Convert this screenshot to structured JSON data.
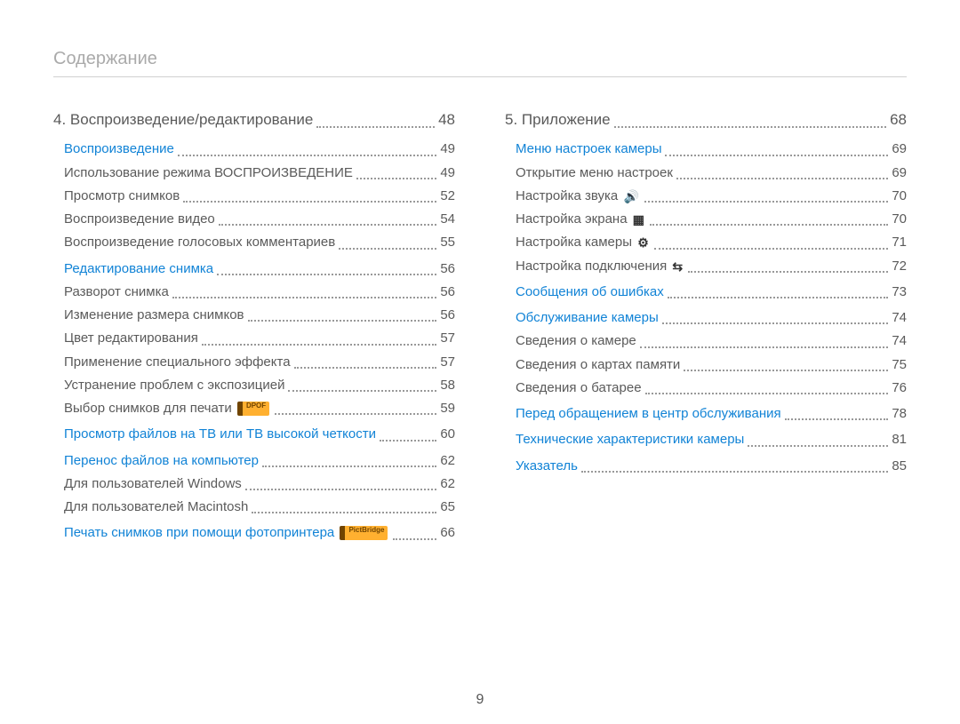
{
  "header": "Содержание",
  "page_number": "9",
  "colors": {
    "link": "#1183d6",
    "text": "#5a5a5a",
    "muted": "#aaa"
  },
  "columns": [
    {
      "items": [
        {
          "level": 1,
          "label": "4. Воспроизведение/редактирование",
          "page": "48",
          "link": false
        },
        {
          "level": 2,
          "label": "Воспроизведение",
          "page": "49",
          "link": true
        },
        {
          "level": 3,
          "label": "Использование режима ВОСПРОИЗВЕДЕНИЕ",
          "page": "49"
        },
        {
          "level": 3,
          "label": "Просмотр снимков",
          "page": "52"
        },
        {
          "level": 3,
          "label": "Воспроизведение видео",
          "page": "54"
        },
        {
          "level": 3,
          "label": "Воспроизведение голосовых комментариев",
          "page": "55"
        },
        {
          "level": 2,
          "label": "Редактирование снимка",
          "page": "56",
          "link": true
        },
        {
          "level": 3,
          "label": "Разворот снимка",
          "page": "56"
        },
        {
          "level": 3,
          "label": "Изменение размера снимков",
          "page": "56"
        },
        {
          "level": 3,
          "label": "Цвет редактирования",
          "page": "57"
        },
        {
          "level": 3,
          "label": "Применение специального эффекта",
          "page": "57"
        },
        {
          "level": 3,
          "label": "Устранение проблем с экспозицией",
          "page": "58"
        },
        {
          "level": 3,
          "label": "Выбор снимков для печати",
          "icon": "dpof",
          "icon_text": "DPOF",
          "page": "59"
        },
        {
          "level": 2,
          "label": "Просмотр файлов на ТВ или ТВ высокой четкости",
          "page": "60",
          "link": true
        },
        {
          "level": 2,
          "label": "Перенос файлов на компьютер",
          "page": "62",
          "link": true
        },
        {
          "level": 3,
          "label": "Для пользователей Windows",
          "page": "62"
        },
        {
          "level": 3,
          "label": "Для пользователей Macintosh",
          "page": "65"
        },
        {
          "level": 2,
          "label": "Печать снимков при помощи фотопринтера",
          "icon": "pictbridge",
          "icon_text": "PictBridge",
          "page": "66",
          "link": true
        }
      ]
    },
    {
      "items": [
        {
          "level": 1,
          "label": "5. Приложение",
          "page": "68",
          "link": false
        },
        {
          "level": 2,
          "label": "Меню настроек камеры",
          "page": "69",
          "link": true
        },
        {
          "level": 3,
          "label": "Открытие меню настроек",
          "page": "69"
        },
        {
          "level": 3,
          "label": "Настройка звука",
          "icon": "sound",
          "icon_text": "🔊",
          "page": "70"
        },
        {
          "level": 3,
          "label": "Настройка экрана",
          "icon": "screen",
          "icon_text": "▦",
          "page": "70"
        },
        {
          "level": 3,
          "label": "Настройка камеры",
          "icon": "gear",
          "icon_text": "⚙",
          "page": "71"
        },
        {
          "level": 3,
          "label": "Настройка подключения",
          "icon": "connect",
          "icon_text": "⇆",
          "page": "72"
        },
        {
          "level": 2,
          "label": "Сообщения об ошибках",
          "page": "73",
          "link": true
        },
        {
          "level": 2,
          "label": "Обслуживание камеры",
          "page": "74",
          "link": true
        },
        {
          "level": 3,
          "label": "Сведения о камере",
          "page": "74"
        },
        {
          "level": 3,
          "label": "Сведения о картах памяти",
          "page": "75"
        },
        {
          "level": 3,
          "label": "Сведения о батарее",
          "page": "76"
        },
        {
          "level": 2,
          "label": "Перед обращением в центр обслуживания",
          "page": "78",
          "link": true
        },
        {
          "level": 2,
          "label": "Технические характеристики камеры",
          "page": "81",
          "link": true
        },
        {
          "level": 2,
          "label": "Указатель",
          "page": "85",
          "link": true
        }
      ]
    }
  ]
}
